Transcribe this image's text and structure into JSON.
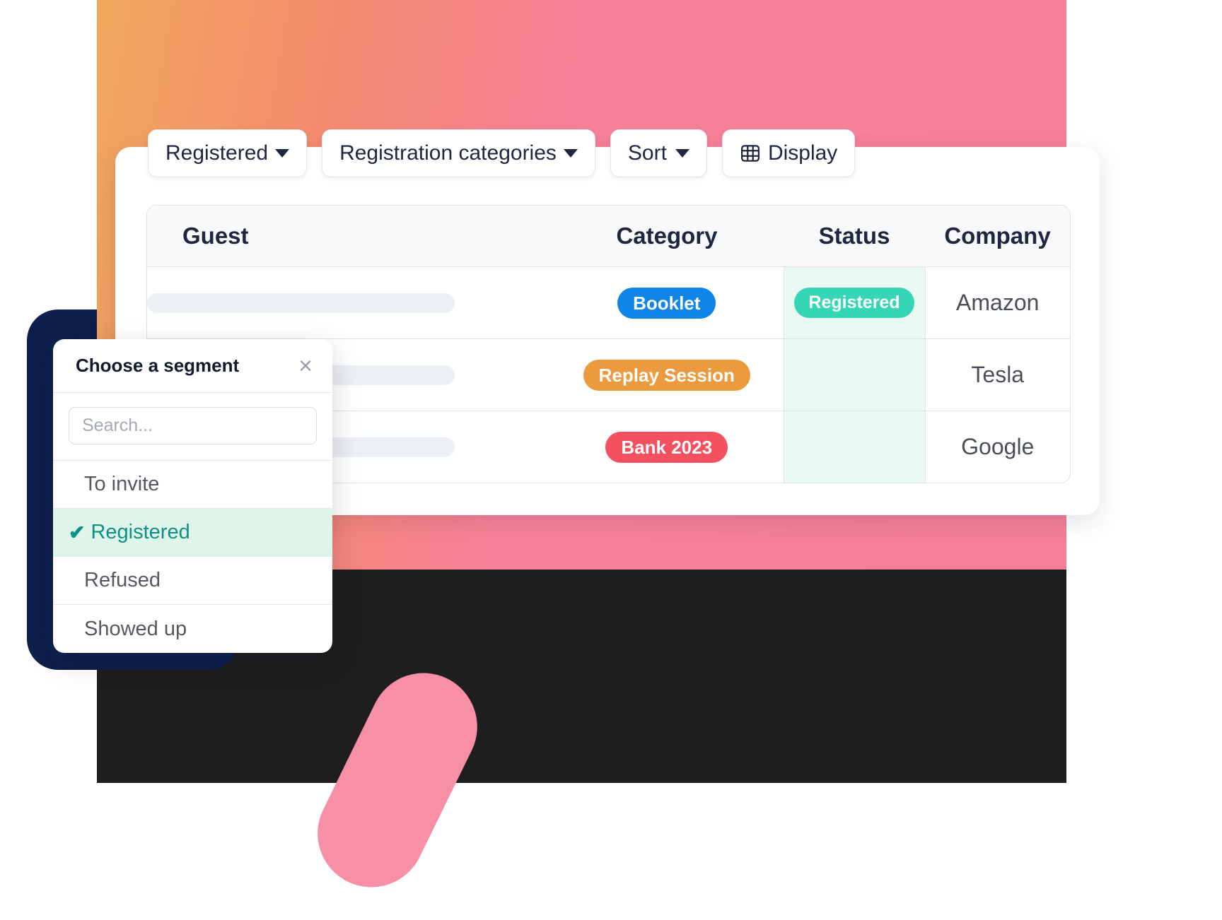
{
  "toolbar": {
    "buttons": [
      {
        "label": "Registered",
        "icon": "chevron-down-icon",
        "has_caret": true
      },
      {
        "label": "Registration categories",
        "icon": "chevron-down-icon",
        "has_caret": true
      },
      {
        "label": "Sort",
        "icon": "chevron-down-icon",
        "has_caret": true
      },
      {
        "label": "Display",
        "icon": "table-grid-icon",
        "has_caret": false
      }
    ]
  },
  "table": {
    "columns": [
      "Guest",
      "Category",
      "Status",
      "Company"
    ],
    "rows": [
      {
        "guest": "",
        "category": "Booklet",
        "category_color": "#0d86e8",
        "status": "Registered",
        "status_color": "#35d6b6",
        "company": "Amazon"
      },
      {
        "guest": "",
        "category": "Replay Session",
        "category_color": "#eb9b3d",
        "status": "",
        "status_color": "",
        "company": "Tesla"
      },
      {
        "guest": "",
        "category": "Bank 2023",
        "category_color": "#f4505f",
        "status": "",
        "status_color": "",
        "company": "Google"
      }
    ]
  },
  "segment_dialog": {
    "title": "Choose a segment",
    "close_label": "×",
    "search_placeholder": "Search...",
    "search_value": "",
    "items": [
      {
        "label": "To invite",
        "selected": false
      },
      {
        "label": "Registered",
        "selected": true
      },
      {
        "label": "Refused",
        "selected": false
      },
      {
        "label": "Showed up",
        "selected": false
      }
    ],
    "check_glyph": "✔"
  },
  "colors": {
    "accent_teal": "#35d6b6",
    "accent_blue": "#0d86e8",
    "accent_orange": "#eb9b3d",
    "accent_red": "#f4505f",
    "navy": "#0e1f4d",
    "pink": "#f78fa7",
    "black_block": "#1e1e1e",
    "status_cell_bg": "#eafaf2",
    "selected_row_bg": "#e0f5ea",
    "selected_text": "#0d9184"
  }
}
